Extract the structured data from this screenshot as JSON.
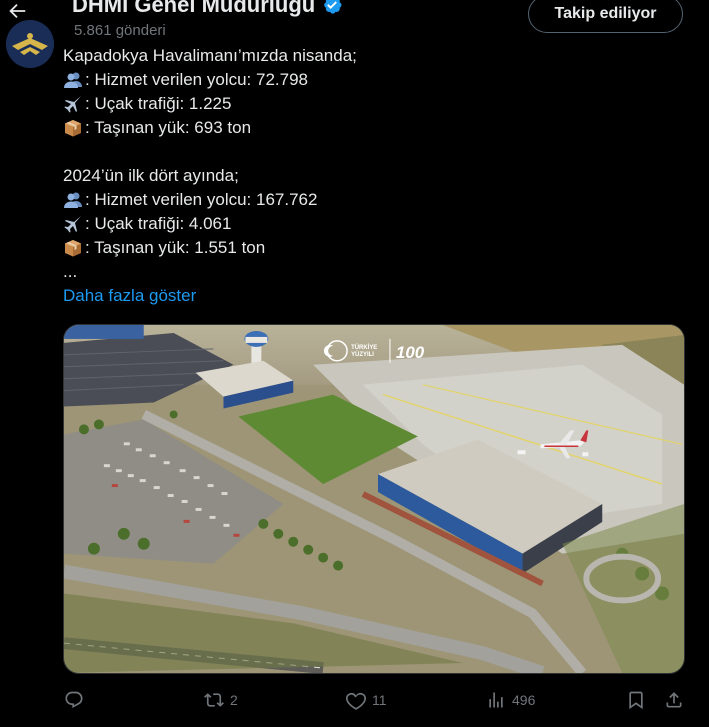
{
  "header": {
    "account_name": "DHMİ Genel Müdürlüğü",
    "post_count": "5.861 gönderi",
    "follow_label": "Takip ediliyor"
  },
  "tweet": {
    "line1": "Kapadokya Havalimanı’mızda nisanda;",
    "line2": ": Hizmet verilen yolcu: 72.798",
    "line3": ": Uçak trafiği: 1.225",
    "line4": ": Taşınan yük: 693 ton",
    "line5": "2024’ün ilk dört ayında;",
    "line6": ": Hizmet verilen yolcu: 167.762",
    "line7": ": Uçak trafiği: 4.061",
    "line8": ": Taşınan yük: 1.551 ton",
    "line9": "...",
    "show_more": "Daha fazla göster"
  },
  "media": {
    "logo_text_1": "TÜRKİYE",
    "logo_text_2": "YÜZYILI",
    "logo_100": "100"
  },
  "actions": {
    "reply_count": "",
    "retweet_count": "2",
    "like_count": "11",
    "view_count": "496"
  },
  "icons": {
    "passenger": "busts-icon",
    "plane": "airplane-icon",
    "cargo": "package-icon"
  },
  "colors": {
    "link": "#1d9bf0",
    "verified": "#1d9bf0",
    "muted": "#71767b"
  }
}
